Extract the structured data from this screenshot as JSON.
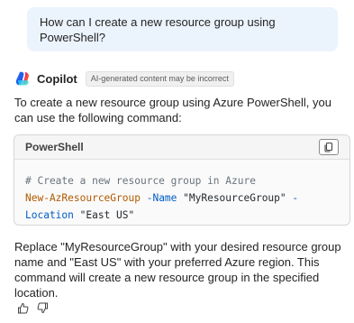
{
  "user_message": {
    "text": "How can I create a new resource group using PowerShell?"
  },
  "assistant": {
    "name": "Copilot",
    "badge": "AI-generated content may be incorrect",
    "intro": "To create a new resource group using Azure PowerShell, you can use the following command:",
    "code_block": {
      "language": "PowerShell",
      "copy_icon": "copy-icon",
      "comment": "# Create a new resource group in Azure",
      "line2_cmd": "New-AzResourceGroup",
      "line2_param": " -Name ",
      "line2_value": "\"MyResourceGroup\"",
      "line2_cont": " -",
      "line3_param": "Location",
      "line3_value": " \"East US\""
    },
    "outro": "Replace \"MyResourceGroup\" with your desired resource group name and \"East US\" with your preferred Azure region. This command will create a new resource group in the specified location.",
    "feedback": {
      "like_icon": "thumbs-up-icon",
      "dislike_icon": "thumbs-down-icon"
    }
  },
  "colors": {
    "user_bubble": "#ebf3fc",
    "comment": "#6a737d",
    "cmdlet": "#b05a00",
    "parameter": "#005cc5"
  }
}
